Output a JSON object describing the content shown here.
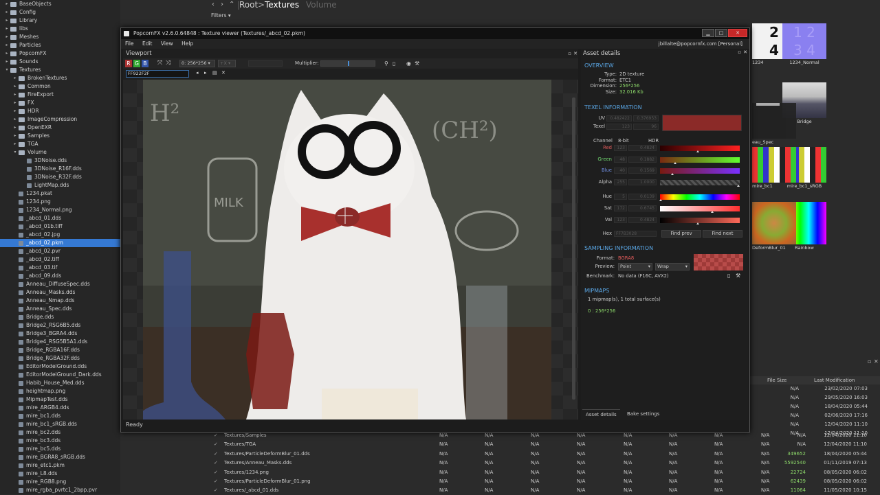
{
  "tree": {
    "items": [
      {
        "label": "BaseObjects",
        "indent": 1,
        "kind": "folder",
        "arrow": "▸"
      },
      {
        "label": "Config",
        "indent": 1,
        "kind": "folder",
        "arrow": "▸"
      },
      {
        "label": "Library",
        "indent": 1,
        "kind": "folder",
        "arrow": "▸"
      },
      {
        "label": "libs",
        "indent": 1,
        "kind": "folder",
        "arrow": "▸"
      },
      {
        "label": "Meshes",
        "indent": 1,
        "kind": "folder",
        "arrow": "▸"
      },
      {
        "label": "Particles",
        "indent": 1,
        "kind": "folder",
        "arrow": "▸"
      },
      {
        "label": "PopcornFX",
        "indent": 1,
        "kind": "folder",
        "arrow": "▸"
      },
      {
        "label": "Sounds",
        "indent": 1,
        "kind": "folder",
        "arrow": "▸"
      },
      {
        "label": "Textures",
        "indent": 1,
        "kind": "folder",
        "arrow": "▾"
      },
      {
        "label": "BrokenTextures",
        "indent": 2,
        "kind": "folder",
        "arrow": "▸"
      },
      {
        "label": "Common",
        "indent": 2,
        "kind": "folder",
        "arrow": "▸"
      },
      {
        "label": "FireExport",
        "indent": 2,
        "kind": "folder",
        "arrow": "▸"
      },
      {
        "label": "FX",
        "indent": 2,
        "kind": "folder",
        "arrow": "▸"
      },
      {
        "label": "HDR",
        "indent": 2,
        "kind": "folder",
        "arrow": "▸"
      },
      {
        "label": "ImageCompression",
        "indent": 2,
        "kind": "folder",
        "arrow": "▸"
      },
      {
        "label": "OpenEXR",
        "indent": 2,
        "kind": "folder",
        "arrow": "▸"
      },
      {
        "label": "Samples",
        "indent": 2,
        "kind": "folder",
        "arrow": "▸"
      },
      {
        "label": "TGA",
        "indent": 2,
        "kind": "folder",
        "arrow": "▸"
      },
      {
        "label": "Volume",
        "indent": 2,
        "kind": "folder",
        "arrow": "▾"
      },
      {
        "label": "3DNoise.dds",
        "indent": 3,
        "kind": "file",
        "arrow": ""
      },
      {
        "label": "3DNoise_R16F.dds",
        "indent": 3,
        "kind": "file",
        "arrow": ""
      },
      {
        "label": "3DNoise_R32F.dds",
        "indent": 3,
        "kind": "file",
        "arrow": ""
      },
      {
        "label": "LightMap.dds",
        "indent": 3,
        "kind": "file",
        "arrow": ""
      },
      {
        "label": "1234.pkat",
        "indent": 2,
        "kind": "file",
        "arrow": ""
      },
      {
        "label": "1234.png",
        "indent": 2,
        "kind": "file",
        "arrow": ""
      },
      {
        "label": "1234_Normal.png",
        "indent": 2,
        "kind": "file",
        "arrow": ""
      },
      {
        "label": "_abcd_01.dds",
        "indent": 2,
        "kind": "file",
        "arrow": ""
      },
      {
        "label": "_abcd_01b.tiff",
        "indent": 2,
        "kind": "file",
        "arrow": ""
      },
      {
        "label": "_abcd_02.jpg",
        "indent": 2,
        "kind": "file",
        "arrow": ""
      },
      {
        "label": "_abcd_02.pkm",
        "indent": 2,
        "kind": "file",
        "arrow": "",
        "selected": true
      },
      {
        "label": "_abcd_02.pvr",
        "indent": 2,
        "kind": "file",
        "arrow": ""
      },
      {
        "label": "_abcd_02.tiff",
        "indent": 2,
        "kind": "file",
        "arrow": ""
      },
      {
        "label": "_abcd_03.tif",
        "indent": 2,
        "kind": "file",
        "arrow": ""
      },
      {
        "label": "_abcd_09.dds",
        "indent": 2,
        "kind": "file",
        "arrow": ""
      },
      {
        "label": "Anneau_DiffuseSpec.dds",
        "indent": 2,
        "kind": "file",
        "arrow": ""
      },
      {
        "label": "Anneau_Masks.dds",
        "indent": 2,
        "kind": "file",
        "arrow": ""
      },
      {
        "label": "Anneau_Nmap.dds",
        "indent": 2,
        "kind": "file",
        "arrow": ""
      },
      {
        "label": "Anneau_Spec.dds",
        "indent": 2,
        "kind": "file",
        "arrow": ""
      },
      {
        "label": "Bridge.dds",
        "indent": 2,
        "kind": "file",
        "arrow": ""
      },
      {
        "label": "Bridge2_RSG6B5.dds",
        "indent": 2,
        "kind": "file",
        "arrow": ""
      },
      {
        "label": "Bridge3_BGRA4.dds",
        "indent": 2,
        "kind": "file",
        "arrow": ""
      },
      {
        "label": "Bridge4_RSG5B5A1.dds",
        "indent": 2,
        "kind": "file",
        "arrow": ""
      },
      {
        "label": "Bridge_RGBA16F.dds",
        "indent": 2,
        "kind": "file",
        "arrow": ""
      },
      {
        "label": "Bridge_RGBA32F.dds",
        "indent": 2,
        "kind": "file",
        "arrow": ""
      },
      {
        "label": "EditorModelGround.dds",
        "indent": 2,
        "kind": "file",
        "arrow": ""
      },
      {
        "label": "EditorModelGround_Dark.dds",
        "indent": 2,
        "kind": "file",
        "arrow": ""
      },
      {
        "label": "Habib_House_Med.dds",
        "indent": 2,
        "kind": "file",
        "arrow": ""
      },
      {
        "label": "heightmap.png",
        "indent": 2,
        "kind": "file",
        "arrow": ""
      },
      {
        "label": "MipmapTest.dds",
        "indent": 2,
        "kind": "file",
        "arrow": ""
      },
      {
        "label": "mire_ARGB4.dds",
        "indent": 2,
        "kind": "file",
        "arrow": ""
      },
      {
        "label": "mire_bc1.dds",
        "indent": 2,
        "kind": "file",
        "arrow": ""
      },
      {
        "label": "mire_bc1_sRGB.dds",
        "indent": 2,
        "kind": "file",
        "arrow": ""
      },
      {
        "label": "mire_bc2.dds",
        "indent": 2,
        "kind": "file",
        "arrow": ""
      },
      {
        "label": "mire_bc3.dds",
        "indent": 2,
        "kind": "file",
        "arrow": ""
      },
      {
        "label": "mire_bc5.dds",
        "indent": 2,
        "kind": "file",
        "arrow": ""
      },
      {
        "label": "mire_BGRA8_sRGB.dds",
        "indent": 2,
        "kind": "file",
        "arrow": ""
      },
      {
        "label": "mire_etc1.pkm",
        "indent": 2,
        "kind": "file",
        "arrow": ""
      },
      {
        "label": "mire_L8.dds",
        "indent": 2,
        "kind": "file",
        "arrow": ""
      },
      {
        "label": "mire_RGB8.png",
        "indent": 2,
        "kind": "file",
        "arrow": ""
      },
      {
        "label": "mire_rgba_pvrtc1_2bpp.pvr",
        "indent": 2,
        "kind": "file",
        "arrow": ""
      }
    ]
  },
  "browser": {
    "crumb_root": "Root",
    "crumb_sep": ">",
    "crumb_current": "Textures",
    "crumb_next": "Volume",
    "filters": "Filters"
  },
  "thumbs": [
    {
      "caption": "1234"
    },
    {
      "caption": "1234_Normal"
    },
    {
      "caption": "Bridge"
    },
    {
      "caption": "eau_Spec"
    },
    {
      "caption": "mire_bc1_sRGB"
    },
    {
      "caption": "mire_bc1"
    },
    {
      "caption": "Rainbow"
    },
    {
      "caption": "DeformBlur_01"
    }
  ],
  "list": {
    "col_size": "File Size",
    "col_mod": "Last Modification",
    "right_rows": [
      {
        "size": "N/A",
        "date": "23/02/2020 07:03"
      },
      {
        "size": "N/A",
        "date": "29/05/2020 16:03"
      },
      {
        "size": "N/A",
        "date": "18/04/2020 05:44"
      },
      {
        "size": "N/A",
        "date": "02/06/2020 17:16"
      },
      {
        "size": "N/A",
        "date": "12/04/2020 11:10"
      },
      {
        "size": "N/A",
        "date": "12/04/2020 11:10"
      }
    ],
    "rows": [
      {
        "path": "Textures/Samples",
        "c": [
          "N/A",
          "N/A",
          "N/A",
          "N/A",
          "N/A",
          "N/A",
          "N/A",
          "N/A"
        ],
        "size": "N/A",
        "date": "12/04/2020 11:10",
        "green": false
      },
      {
        "path": "Textures/TGA",
        "c": [
          "N/A",
          "N/A",
          "N/A",
          "N/A",
          "N/A",
          "N/A",
          "N/A",
          "N/A"
        ],
        "size": "N/A",
        "date": "12/04/2020 11:10",
        "green": false
      },
      {
        "path": "Textures/ParticleDeformBlur_01.dds",
        "c": [
          "N/A",
          "N/A",
          "N/A",
          "N/A",
          "N/A",
          "N/A",
          "N/A",
          "N/A"
        ],
        "size": "349652",
        "date": "18/04/2020 05:44",
        "green": true
      },
      {
        "path": "Textures/Anneau_Masks.dds",
        "c": [
          "N/A",
          "N/A",
          "N/A",
          "N/A",
          "N/A",
          "N/A",
          "N/A",
          "N/A"
        ],
        "size": "5592540",
        "date": "01/11/2019 07:13",
        "green": true
      },
      {
        "path": "Textures/1234.png",
        "c": [
          "N/A",
          "N/A",
          "N/A",
          "N/A",
          "N/A",
          "N/A",
          "N/A",
          "N/A"
        ],
        "size": "22724",
        "date": "08/05/2020 06:02",
        "green": true
      },
      {
        "path": "Textures/ParticleDeformBlur_01.png",
        "c": [
          "N/A",
          "N/A",
          "N/A",
          "N/A",
          "N/A",
          "N/A",
          "N/A",
          "N/A"
        ],
        "size": "62439",
        "date": "08/05/2020 06:02",
        "green": true
      },
      {
        "path": "Textures/_abcd_01.dds",
        "c": [
          "N/A",
          "N/A",
          "N/A",
          "N/A",
          "N/A",
          "N/A",
          "N/A",
          "N/A"
        ],
        "size": "11064",
        "date": "11/05/2020 10:15",
        "green": true
      }
    ]
  },
  "window": {
    "title": "PopcornFX v2.6.0.64848  : Texture viewer (Textures/_abcd_02.pkm)",
    "user": "jbillalte@popcornfx.com [Personal]",
    "menu": [
      "File",
      "Edit",
      "View",
      "Help"
    ],
    "status": "Ready",
    "min": "▁",
    "max": "□",
    "close": "✕"
  },
  "viewport": {
    "title": "Viewport",
    "channels": [
      "R",
      "G",
      "B"
    ],
    "mip_select": "0: 256*256",
    "x_select": "+X",
    "multiplier_label": "Multiplier:",
    "find_value": "FF922F2F"
  },
  "asset": {
    "title": "Asset details",
    "overview_title": "OVERVIEW",
    "overview": [
      {
        "k": "Type:",
        "v": "2D texture",
        "style": ""
      },
      {
        "k": "Format:",
        "v": "ETC1",
        "style": ""
      },
      {
        "k": "Dimension:",
        "v": "256*256",
        "style": "g"
      },
      {
        "k": "Size:",
        "v": "32.016 Kb",
        "style": "g"
      }
    ],
    "texel_title": "TEXEL INFORMATION",
    "uv_label": "UV",
    "uv": [
      "0.482422",
      "0.376953"
    ],
    "texel_label": "Texel",
    "texel": [
      "123",
      "96"
    ],
    "texel_color": "#8b2a28",
    "channel_head": [
      "Channel",
      "8-bit",
      "HDR"
    ],
    "channels": [
      {
        "label": "Red",
        "v8": "123",
        "hdr": "0.4824",
        "style": "r",
        "grad": "linear-gradient(90deg,#2a0000,#ff2020)",
        "mark": 0.48
      },
      {
        "label": "Green",
        "v8": "48",
        "hdr": "0.1882",
        "style": "gr",
        "grad": "linear-gradient(90deg,#7a2a10,#60ff30)",
        "mark": 0.19
      },
      {
        "label": "Blue",
        "v8": "40",
        "hdr": "0.1569",
        "style": "b",
        "grad": "linear-gradient(90deg,#7a1a10,#7a30ff)",
        "mark": 0.16
      },
      {
        "label": "Alpha",
        "v8": "255",
        "hdr": "1.0000",
        "style": "",
        "grad": "repeating-linear-gradient(45deg,#555 0 3px,#333 3px 6px)",
        "mark": 1.0
      }
    ],
    "hsv": [
      {
        "label": "Hue",
        "v8": "5",
        "hdr": "0.0139",
        "grad": "linear-gradient(90deg,#f00,#ff0,#0f0,#0ff,#00f,#f0f,#f00)",
        "mark": 0.01
      },
      {
        "label": "Sat",
        "v8": "172",
        "hdr": "0.6745",
        "grad": "linear-gradient(90deg,#fff,#ff3030)",
        "mark": 0.67
      },
      {
        "label": "Val",
        "v8": "123",
        "hdr": "0.4824",
        "grad": "linear-gradient(90deg,#000,#ff6a5a)",
        "mark": 0.48
      }
    ],
    "hex_label": "Hex",
    "hex": "FF7B3028",
    "find_prev": "Find prev",
    "find_next": "Find next",
    "sampling_title": "SAMPLING INFORMATION",
    "format_label": "Format:",
    "format": "BGRA8",
    "preview_label": "Preview:",
    "preview_filter": "Point",
    "preview_wrap": "Wrap",
    "bench_label": "Benchmark:",
    "bench": "No data (F16C, AVX2)",
    "mip_title": "MIPMAPS",
    "mip_summary": "1 mipmap(s), 1 total surface(s)",
    "mip_entry": "0 : 256*256",
    "tab_details": "Asset details",
    "tab_bake": "Bake settings"
  }
}
